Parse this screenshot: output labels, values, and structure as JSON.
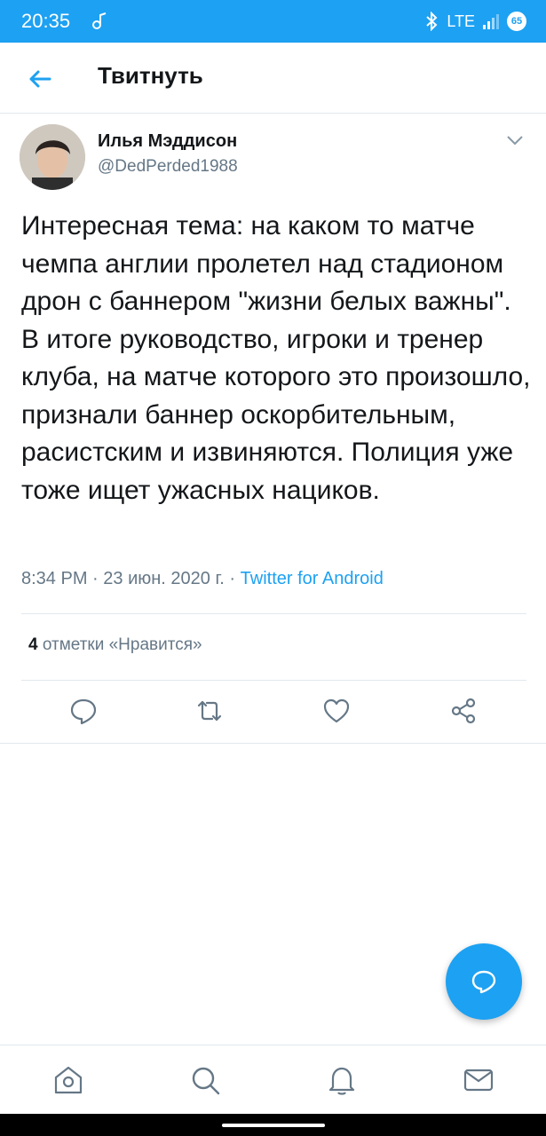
{
  "status_bar": {
    "time": "20:35",
    "network": "LTE",
    "battery": "65",
    "icons": [
      "music-note-icon",
      "bluetooth-icon",
      "signal-icon",
      "battery-icon"
    ]
  },
  "header": {
    "title": "Твитнуть",
    "back_icon": "arrow-left-icon"
  },
  "tweet": {
    "author_name": "Илья Мэддисон",
    "author_handle": "@DedPerded1988",
    "text": "Интересная тема: на каком то матче чемпа англии пролетел над стадионом дрон с баннером \"жизни белых важны\". В итоге руководство, игроки и тренер клуба, на матче которого это произошло, признали баннер оскорбительным, расистским и извиняются. Полиция уже тоже ищет ужасных нациков.",
    "time": "8:34 PM",
    "date": "23 июн. 2020 г.",
    "separator": " · ",
    "source": "Twitter for Android",
    "likes_count": "4",
    "likes_label": " отметки «Нравится»"
  },
  "actions": [
    "reply-icon",
    "retweet-icon",
    "like-icon",
    "share-icon"
  ],
  "bottom_nav": [
    "home-icon",
    "search-icon",
    "notifications-icon",
    "messages-icon"
  ],
  "colors": {
    "accent": "#1da1f2",
    "text": "#14171a",
    "secondary": "#657786",
    "divider": "#e1e8ed"
  }
}
